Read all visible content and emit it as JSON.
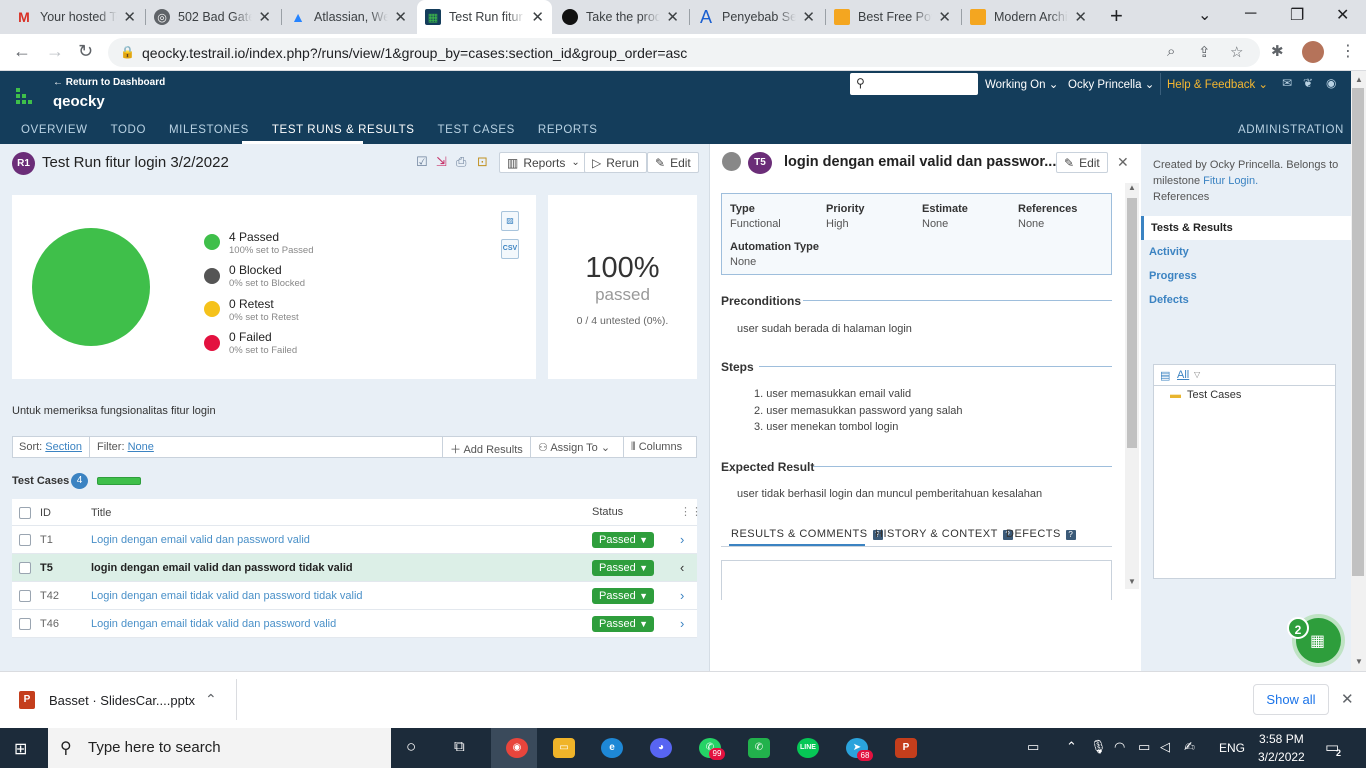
{
  "browser": {
    "tabs": [
      {
        "title": "Your hosted TestRail",
        "icon": "gmail-icon"
      },
      {
        "title": "502 Bad Gateway",
        "icon": "globe-icon"
      },
      {
        "title": "Atlassian, Welcome",
        "icon": "atlassian-icon"
      },
      {
        "title": "Test Run fitur login",
        "icon": "testrail-icon",
        "active": true
      },
      {
        "title": "Take the product",
        "icon": "circle-icon"
      },
      {
        "title": "Penyebab Sering",
        "icon": "a-icon"
      },
      {
        "title": "Best Free PowerPoint",
        "icon": "slides-icon"
      },
      {
        "title": "Modern Architecture",
        "icon": "slides-icon"
      }
    ],
    "url": "qeocky.testrail.io/index.php?/runs/view/1&group_by=cases:section_id&group_order=asc"
  },
  "header": {
    "return_label": "← Return to Dashboard",
    "project": "qeocky",
    "nav": [
      "OVERVIEW",
      "TODO",
      "MILESTONES",
      "TEST RUNS & RESULTS",
      "TEST CASES",
      "REPORTS"
    ],
    "admin": "ADMINISTRATION",
    "working_on": "Working On",
    "user": "Ocky Princella",
    "help": "Help & Feedback"
  },
  "run": {
    "badge": "R1",
    "title": "Test Run fitur login 3/2/2022",
    "reports_label": "Reports",
    "rerun_label": "Rerun",
    "edit_label": "Edit",
    "description": "Untuk memeriksa fungsionalitas fitur login",
    "legend": [
      {
        "title": "4 Passed",
        "sub": "100% set to Passed",
        "color": "#3fbf4a"
      },
      {
        "title": "0 Blocked",
        "sub": "0% set to Blocked",
        "color": "#555555"
      },
      {
        "title": "0 Retest",
        "sub": "0% set to Retest",
        "color": "#f5c21b"
      },
      {
        "title": "0 Failed",
        "sub": "0% set to Failed",
        "color": "#e3113f"
      }
    ],
    "csv_label": "CSV",
    "percent": "100%",
    "percent_word": "passed",
    "untested": "0 / 4 untested (0%)."
  },
  "filter": {
    "sort_label": "Sort:",
    "sort_value": "Section",
    "filter_label": "Filter:",
    "filter_value": "None",
    "add_results": "Add Results",
    "assign_to": "Assign To",
    "columns": "Columns"
  },
  "testcases": {
    "label": "Test Cases",
    "count": "4",
    "headers": {
      "id": "ID",
      "title": "Title",
      "status": "Status"
    },
    "rows": [
      {
        "id": "T1",
        "title": "Login dengan email valid dan password valid",
        "status": "Passed"
      },
      {
        "id": "T5",
        "title": "login dengan email valid dan password tidak valid",
        "status": "Passed",
        "selected": true
      },
      {
        "id": "T42",
        "title": "Login dengan email tidak valid dan password tidak valid",
        "status": "Passed"
      },
      {
        "id": "T46",
        "title": "Login dengan email tidak valid dan password valid",
        "status": "Passed"
      }
    ]
  },
  "detail": {
    "badge": "T5",
    "title": "login dengan email valid dan passwor...",
    "edit_label": "Edit",
    "props": [
      {
        "label": "Type",
        "value": "Functional"
      },
      {
        "label": "Priority",
        "value": "High"
      },
      {
        "label": "Estimate",
        "value": "None"
      },
      {
        "label": "References",
        "value": "None"
      },
      {
        "label": "Automation Type",
        "value": "None"
      }
    ],
    "preconditions_label": "Preconditions",
    "preconditions": "user sudah berada di halaman login",
    "steps_label": "Steps",
    "steps": [
      "1. user memasukkan email valid",
      "2. user memasukkan password yang salah",
      "3. user menekan tombol login"
    ],
    "expected_label": "Expected Result",
    "expected": "user tidak berhasil login dan muncul pemberitahuan kesalahan",
    "tabs": [
      "RESULTS & COMMENTS",
      "HISTORY & CONTEXT",
      "DEFECTS"
    ],
    "tab_badge": "?"
  },
  "sidebar": {
    "created_prefix": "Created by Ocky Princella. Belongs to milestone",
    "milestone": "Fitur Login.",
    "references": "References",
    "menu": [
      "Tests & Results",
      "Activity",
      "Progress",
      "Defects"
    ],
    "tree_all": "All",
    "tree_item": "Test Cases",
    "fab_badge": "2"
  },
  "download": {
    "file": "Basset · SlidesCar....pptx",
    "show_all": "Show all"
  },
  "taskbar": {
    "search": "Type here to search",
    "lang": "ENG",
    "time": "3:58 PM",
    "date": "3/2/2022",
    "whatsapp_badge": "99",
    "telegram_badge": "68",
    "notif": "2"
  }
}
